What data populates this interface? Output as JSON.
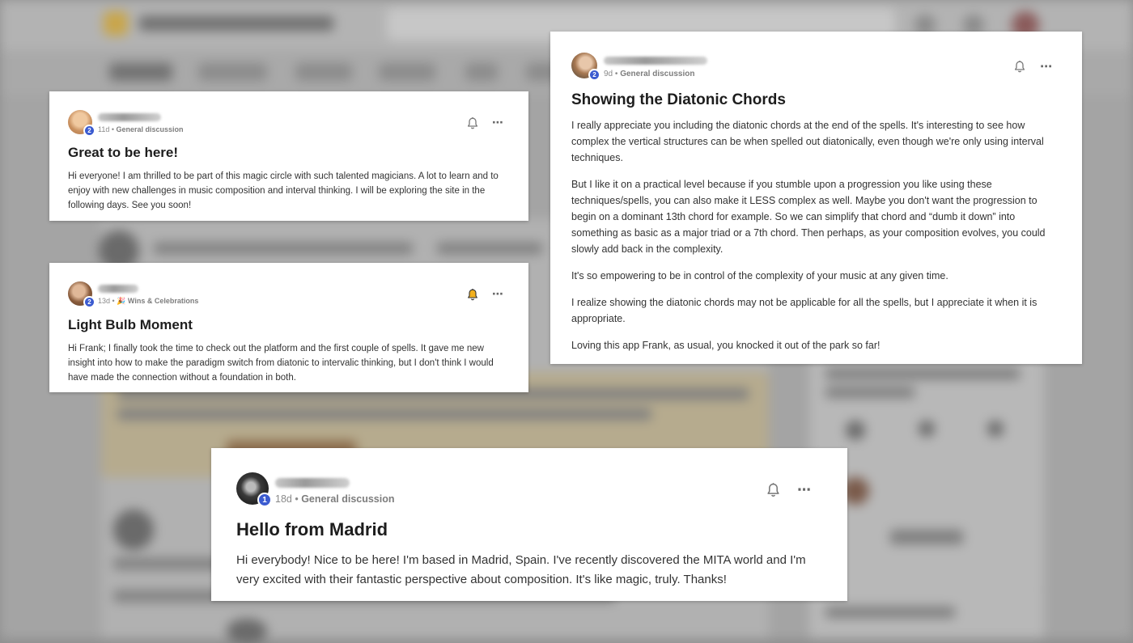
{
  "posts": [
    {
      "id": "great-to-be-here",
      "level": "2",
      "age": "11d",
      "category": "General discussion",
      "title": "Great to be here!",
      "body": [
        "Hi everyone! I am thrilled to be part of this magic circle with such talented magicians. A lot to learn and to enjoy with new challenges in music composition and interval thinking. I will be exploring the site in the following days. See you soon!"
      ],
      "bell_icon": "bell-outline-icon",
      "more_icon": "more-horizontal-icon"
    },
    {
      "id": "light-bulb-moment",
      "level": "2",
      "age": "13d",
      "category_emoji": "🎉",
      "category": "Wins & Celebrations",
      "title": "Light Bulb Moment",
      "body": [
        "Hi Frank; I finally took the time to check out the platform and the first couple of spells. It gave me new insight into how to make the paradigm switch from diatonic to intervalic thinking, but I don't think I would have made the connection without a foundation in both."
      ],
      "bell_icon": "bell-filled-icon",
      "bell_color": "#f2b01e",
      "more_icon": "more-horizontal-icon"
    },
    {
      "id": "diatonic-chords",
      "level": "2",
      "age": "9d",
      "category": "General discussion",
      "title": "Showing the Diatonic Chords",
      "body": [
        "I really appreciate you including the diatonic chords at the end of the spells. It's interesting to see how complex the vertical structures can be when spelled out diatonically, even though we're only using interval techniques.",
        "But I like it on a practical level because if you stumble upon a progression you like using these techniques/spells, you can also make it LESS complex as well. Maybe you don't want the progression to begin on a dominant 13th chord for example. So we can simplify that chord and “dumb it down” into something as basic as a major triad or a 7th chord. Then perhaps, as your composition evolves, you could slowly add back in the complexity.",
        "It's so empowering to be in control of the complexity of your music at any given time.",
        "I realize showing the diatonic chords may not be applicable for all the spells, but I appreciate it when it is appropriate.",
        "Loving this app Frank, as usual, you knocked it out of the park so far!"
      ],
      "bell_icon": "bell-outline-icon",
      "more_icon": "more-horizontal-icon"
    },
    {
      "id": "hello-madrid",
      "level": "1",
      "age": "18d",
      "category": "General discussion",
      "title": "Hello from Madrid",
      "body": [
        "Hi everybody! Nice to be here! I'm based in Madrid, Spain. I've recently discovered the MITA world and I'm very excited with their fantastic perspective about composition. It's like magic, truly. Thanks!"
      ],
      "bell_icon": "bell-outline-icon",
      "more_icon": "more-horizontal-icon"
    }
  ],
  "colors": {
    "level_badge": "#3b5bd0",
    "bell_active": "#f2b01e",
    "meta_text": "#8a8a8a",
    "title_text": "#1d1d1d"
  }
}
